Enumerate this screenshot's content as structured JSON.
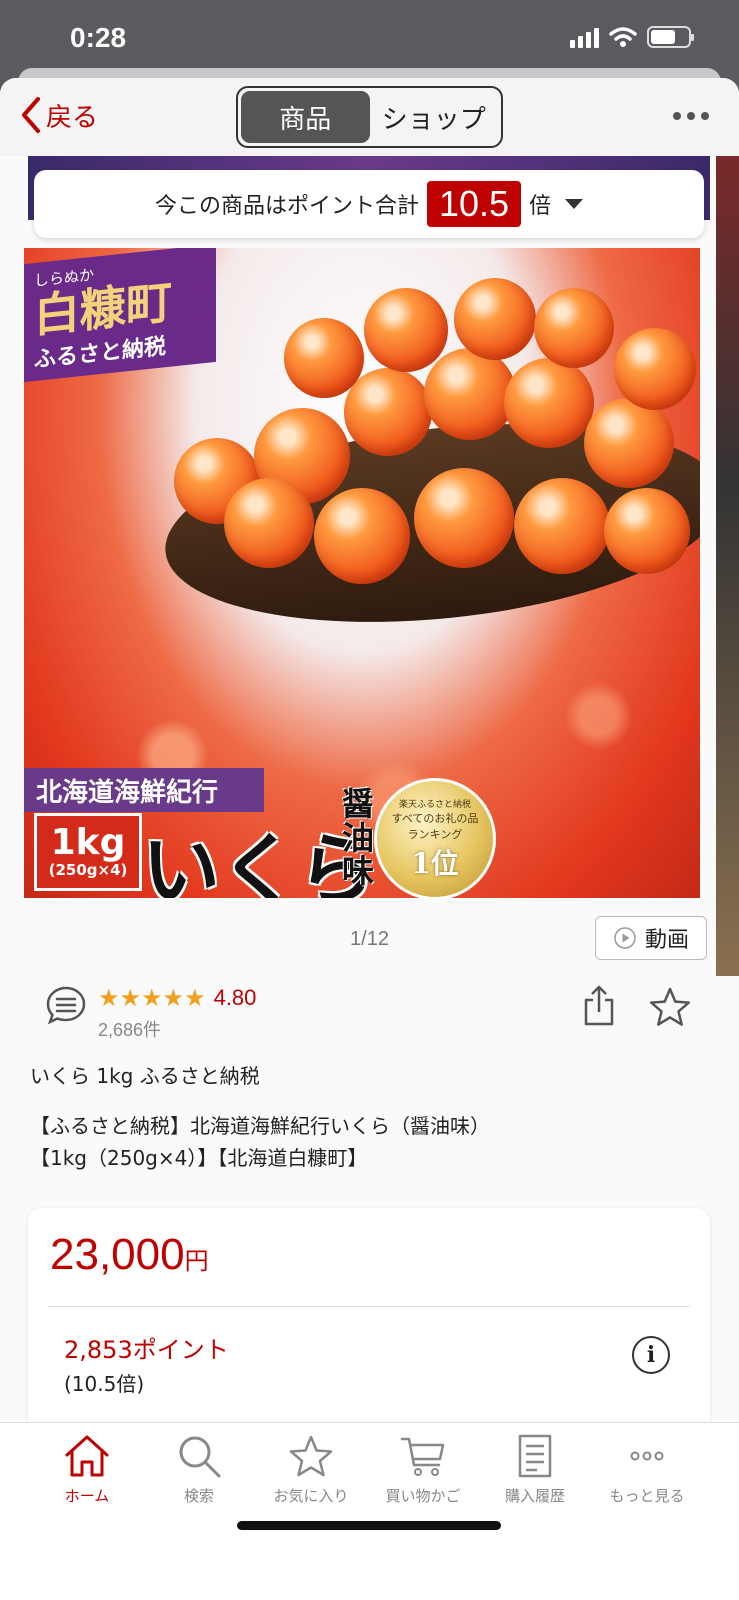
{
  "status_bar": {
    "time": "0:28"
  },
  "nav": {
    "back_label": "戻る",
    "segments": [
      "商品",
      "ショップ"
    ],
    "active_segment": "商品"
  },
  "points_banner": {
    "prefix": "今この商品はポイント合計",
    "multiplier": "10.5",
    "suffix": "倍"
  },
  "hero_image": {
    "kana": "しらぬか",
    "town": "白糠町",
    "furusato": "ふるさと納税",
    "band": "北海道海鮮紀行",
    "weight": "1kg",
    "weight_detail": "(250g×4)",
    "product": "いくら",
    "flavor": "醤油味",
    "medal_line1": "楽天ふるさと納税",
    "medal_line2": "すべてのお礼の品",
    "medal_line3": "ランキング",
    "medal_rank": "1位"
  },
  "gallery": {
    "counter": "1/12",
    "video_label": "動画"
  },
  "reviews": {
    "stars": "★★★★★",
    "rating": "4.80",
    "count": "2,686件"
  },
  "product": {
    "short_title": "いくら 1kg ふるさと納税",
    "title_line1": "【ふるさと納税】北海道海鮮紀行いくら（醤油味）",
    "title_line2": "【1kg（250g×4）】【北海道白糠町】"
  },
  "price": {
    "amount": "23,000",
    "unit": "円",
    "points": "2,853ポイント",
    "points_rate": "(10.5倍)"
  },
  "tabbar": {
    "items": [
      {
        "label": "ホーム",
        "icon": "home-icon",
        "active": true
      },
      {
        "label": "検索",
        "icon": "search-icon"
      },
      {
        "label": "お気に入り",
        "icon": "star-icon"
      },
      {
        "label": "買い物かご",
        "icon": "cart-icon"
      },
      {
        "label": "購入履歴",
        "icon": "receipt-icon"
      },
      {
        "label": "もっと見る",
        "icon": "more-icon"
      }
    ]
  },
  "colors": {
    "accent": "#bf0000",
    "star": "#f0a020"
  }
}
